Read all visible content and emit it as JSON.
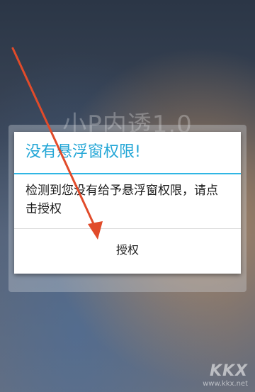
{
  "background": {
    "app_title": "小P内透1.0"
  },
  "dialog": {
    "title": "没有悬浮窗权限!",
    "message": "检测到您没有给予悬浮窗权限，请点击授权",
    "button_label": "授权"
  },
  "watermark": {
    "logo": "KKX",
    "url": "www.kkx.net"
  },
  "colors": {
    "accent": "#30b6e4",
    "arrow": "#e14b2a"
  }
}
